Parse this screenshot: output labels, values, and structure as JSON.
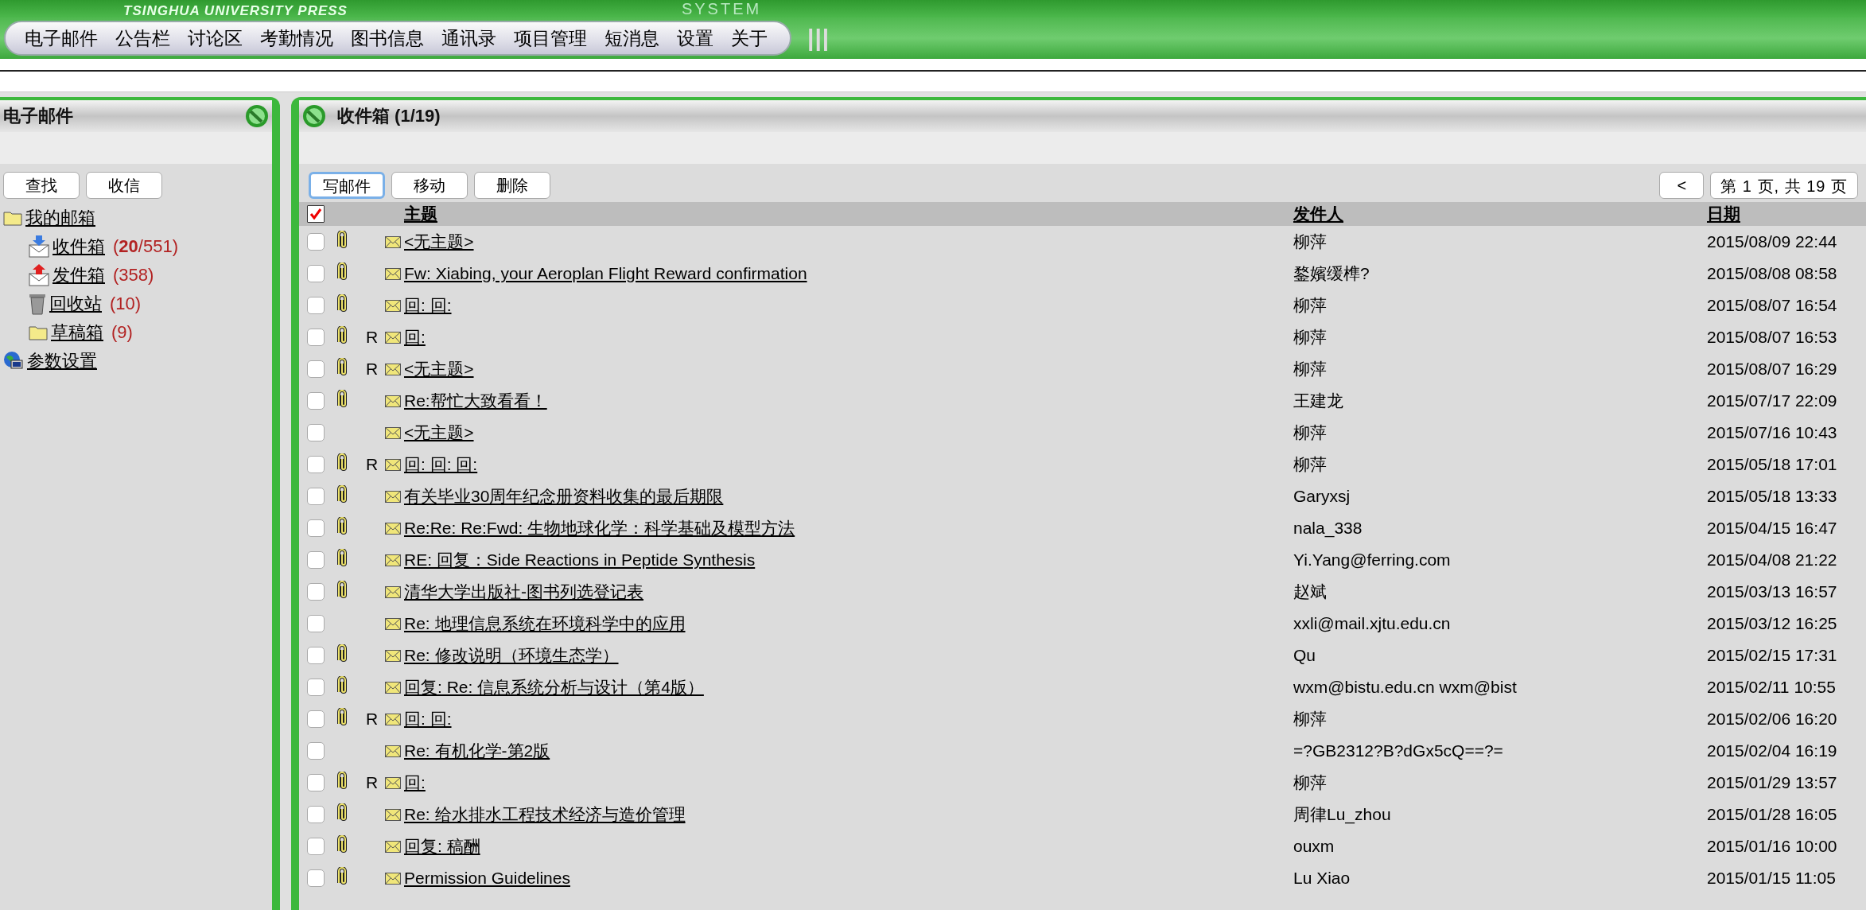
{
  "header": {
    "publisher": "TSINGHUA UNIVERSITY PRESS",
    "system": "SYSTEM"
  },
  "nav": {
    "items": [
      "电子邮件",
      "公告栏",
      "讨论区",
      "考勤情况",
      "图书信息",
      "通讯录",
      "项目管理",
      "短消息",
      "设置",
      "关于"
    ],
    "handle": "|||"
  },
  "sidebar": {
    "title": "电子邮件",
    "buttons": [
      "查找",
      "收信"
    ],
    "tree": {
      "label": "我的邮箱",
      "kind": "folder",
      "children": [
        {
          "label": "收件箱",
          "count": "(**20**/551)",
          "kind": "inbox"
        },
        {
          "label": "发件箱",
          "count": "(358)",
          "kind": "outbox"
        },
        {
          "label": "回收站",
          "count": "(10)",
          "kind": "trash"
        },
        {
          "label": "草稿箱",
          "count": "(9)",
          "kind": "folder"
        }
      ]
    },
    "settings": {
      "label": "参数设置"
    }
  },
  "main": {
    "title": "收件箱 (1/19)",
    "toolbar": [
      {
        "label": "写邮件",
        "focused": true
      },
      {
        "label": "移动",
        "focused": false
      },
      {
        "label": "删除",
        "focused": false
      }
    ],
    "pager": {
      "prev": "<",
      "page": "第 1 页, 共 19 页"
    },
    "table": {
      "select_all": {
        "checked": true
      },
      "columns": [
        "主题",
        "发件人",
        "日期"
      ],
      "rows": [
        {
          "checked": false,
          "attachment": true,
          "subject": "<无主题>",
          "sender": "柳萍",
          "date": "2015/08/09 22:44"
        },
        {
          "checked": false,
          "attachment": true,
          "subject": "Fw: Xiabing, your Aeroplan Flight Reward confirmation",
          "sender": "鍪嬪缓榫?",
          "date": "2015/08/08 08:58"
        },
        {
          "checked": false,
          "attachment": true,
          "subject": "回: 回:",
          "sender": "柳萍",
          "date": "2015/08/07 16:54"
        },
        {
          "checked": false,
          "attachment": true,
          "reply_mark": "R",
          "subject": "回:",
          "sender": "柳萍",
          "date": "2015/08/07 16:53"
        },
        {
          "checked": false,
          "attachment": true,
          "reply_mark": "R",
          "subject": "<无主题>",
          "sender": "柳萍",
          "date": "2015/08/07 16:29"
        },
        {
          "checked": false,
          "attachment": true,
          "subject": "Re:帮忙大致看看！",
          "sender": "王建龙",
          "date": "2015/07/17 22:09"
        },
        {
          "checked": false,
          "attachment": false,
          "subject": "<无主题>",
          "sender": "柳萍",
          "date": "2015/07/16 10:43"
        },
        {
          "checked": false,
          "attachment": true,
          "reply_mark": "R",
          "subject": "回: 回: 回:",
          "sender": "柳萍",
          "date": "2015/05/18 17:01"
        },
        {
          "checked": false,
          "attachment": true,
          "subject": "有关毕业30周年纪念册资料收集的最后期限",
          "sender": "Garyxsj",
          "date": "2015/05/18 13:33"
        },
        {
          "checked": false,
          "attachment": true,
          "subject": "Re:Re: Re:Fwd: 生物地球化学：科学基础及模型方法",
          "sender": "nala_338",
          "date": "2015/04/15 16:47"
        },
        {
          "checked": false,
          "attachment": true,
          "subject": "RE: 回复：Side Reactions in Peptide Synthesis",
          "sender": "Yi.Yang@ferring.com",
          "date": "2015/04/08 21:22"
        },
        {
          "checked": false,
          "attachment": true,
          "subject": "清华大学出版社-图书列选登记表",
          "sender": "赵斌",
          "date": "2015/03/13 16:57"
        },
        {
          "checked": false,
          "attachment": false,
          "subject": "Re: 地理信息系统在环境科学中的应用",
          "sender": "xxli@mail.xjtu.edu.cn",
          "date": "2015/03/12 16:25"
        },
        {
          "checked": false,
          "attachment": true,
          "subject": "Re: 修改说明（环境生态学）",
          "sender": "Qu",
          "date": "2015/02/15 17:31"
        },
        {
          "checked": false,
          "attachment": true,
          "subject": "回复: Re: 信息系统分析与设计（第4版）",
          "sender": "wxm@bistu.edu.cn wxm@bist",
          "date": "2015/02/11 10:55"
        },
        {
          "checked": false,
          "attachment": true,
          "reply_mark": "R",
          "subject": "回: 回:",
          "sender": "柳萍",
          "date": "2015/02/06 16:20"
        },
        {
          "checked": false,
          "attachment": false,
          "subject": "Re: 有机化学-第2版",
          "sender": "=?GB2312?B?dGx5cQ==?=",
          "date": "2015/02/04 16:19"
        },
        {
          "checked": false,
          "attachment": true,
          "reply_mark": "R",
          "subject": "回:",
          "sender": "柳萍",
          "date": "2015/01/29 13:57"
        },
        {
          "checked": false,
          "attachment": true,
          "subject": "Re: 给水排水工程技术经济与造价管理",
          "sender": "周律Lu_zhou",
          "date": "2015/01/28 16:05"
        },
        {
          "checked": false,
          "attachment": true,
          "subject": "回复: 稿酬",
          "sender": "ouxm",
          "date": "2015/01/16 10:00"
        },
        {
          "checked": false,
          "attachment": true,
          "subject": "Permission Guidelines",
          "sender": "Lu Xiao",
          "date": "2015/01/15 11:05"
        }
      ]
    }
  }
}
